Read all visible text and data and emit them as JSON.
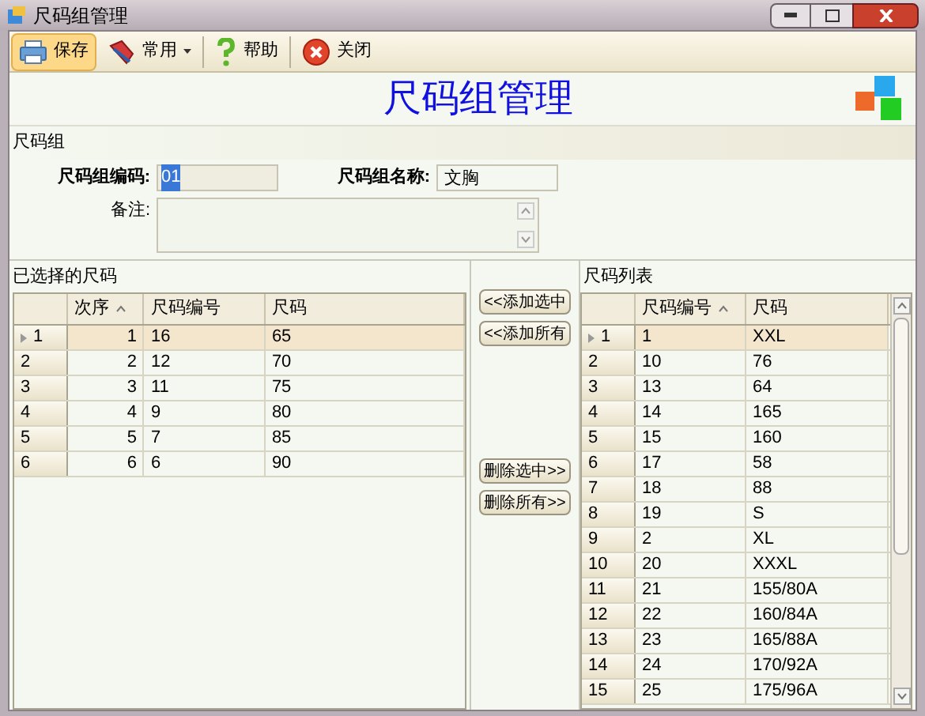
{
  "window": {
    "title": "尺码组管理"
  },
  "toolbar": [
    {
      "label": "保存",
      "kind": "save",
      "selected": true,
      "dropdown": false
    },
    {
      "label": "常用",
      "kind": "tools",
      "selected": false,
      "dropdown": true
    },
    {
      "label": "帮助",
      "kind": "help",
      "selected": false,
      "dropdown": false
    },
    {
      "label": "关闭",
      "kind": "close",
      "selected": false,
      "dropdown": false
    }
  ],
  "heading": "尺码组管理",
  "group": {
    "title": "尺码组",
    "code_label": "尺码组编码:",
    "code_value": "01",
    "name_label": "尺码组名称:",
    "name_value": "文胸",
    "note_label": "备注:"
  },
  "selected_sizes": {
    "title": "已选择的尺码",
    "columns": [
      {
        "label": "次序",
        "sorted": true
      },
      {
        "label": "尺码编号",
        "sorted": false
      },
      {
        "label": "尺码",
        "sorted": false
      }
    ],
    "rows": [
      {
        "header": "1",
        "selected": true,
        "cells": [
          "1",
          "16",
          "65"
        ]
      },
      {
        "header": "2",
        "selected": false,
        "cells": [
          "2",
          "12",
          "70"
        ]
      },
      {
        "header": "3",
        "selected": false,
        "cells": [
          "3",
          "11",
          "75"
        ]
      },
      {
        "header": "4",
        "selected": false,
        "cells": [
          "4",
          "9",
          "80"
        ]
      },
      {
        "header": "5",
        "selected": false,
        "cells": [
          "5",
          "7",
          "85"
        ]
      },
      {
        "header": "6",
        "selected": false,
        "cells": [
          "6",
          "6",
          "90"
        ]
      }
    ]
  },
  "actions": [
    "<<添加选中",
    "<<添加所有",
    "删除选中>>",
    "删除所有>>"
  ],
  "size_list": {
    "title": "尺码列表",
    "columns": [
      {
        "label": "尺码编号",
        "sorted": true
      },
      {
        "label": "尺码",
        "sorted": false
      }
    ],
    "rows": [
      {
        "header": "1",
        "selected": true,
        "cells": [
          "1",
          "XXL"
        ]
      },
      {
        "header": "2",
        "selected": false,
        "cells": [
          "10",
          "76"
        ]
      },
      {
        "header": "3",
        "selected": false,
        "cells": [
          "13",
          "64"
        ]
      },
      {
        "header": "4",
        "selected": false,
        "cells": [
          "14",
          "165"
        ]
      },
      {
        "header": "5",
        "selected": false,
        "cells": [
          "15",
          "160"
        ]
      },
      {
        "header": "6",
        "selected": false,
        "cells": [
          "17",
          "58"
        ]
      },
      {
        "header": "7",
        "selected": false,
        "cells": [
          "18",
          "88"
        ]
      },
      {
        "header": "8",
        "selected": false,
        "cells": [
          "19",
          "S"
        ]
      },
      {
        "header": "9",
        "selected": false,
        "cells": [
          "2",
          "XL"
        ]
      },
      {
        "header": "10",
        "selected": false,
        "cells": [
          "20",
          "XXXL"
        ]
      },
      {
        "header": "11",
        "selected": false,
        "cells": [
          "21",
          "155/80A"
        ]
      },
      {
        "header": "12",
        "selected": false,
        "cells": [
          "22",
          "160/84A"
        ]
      },
      {
        "header": "13",
        "selected": false,
        "cells": [
          "23",
          "165/88A"
        ]
      },
      {
        "header": "14",
        "selected": false,
        "cells": [
          "24",
          "170/92A"
        ]
      },
      {
        "header": "15",
        "selected": false,
        "cells": [
          "25",
          "175/96A"
        ]
      }
    ]
  }
}
